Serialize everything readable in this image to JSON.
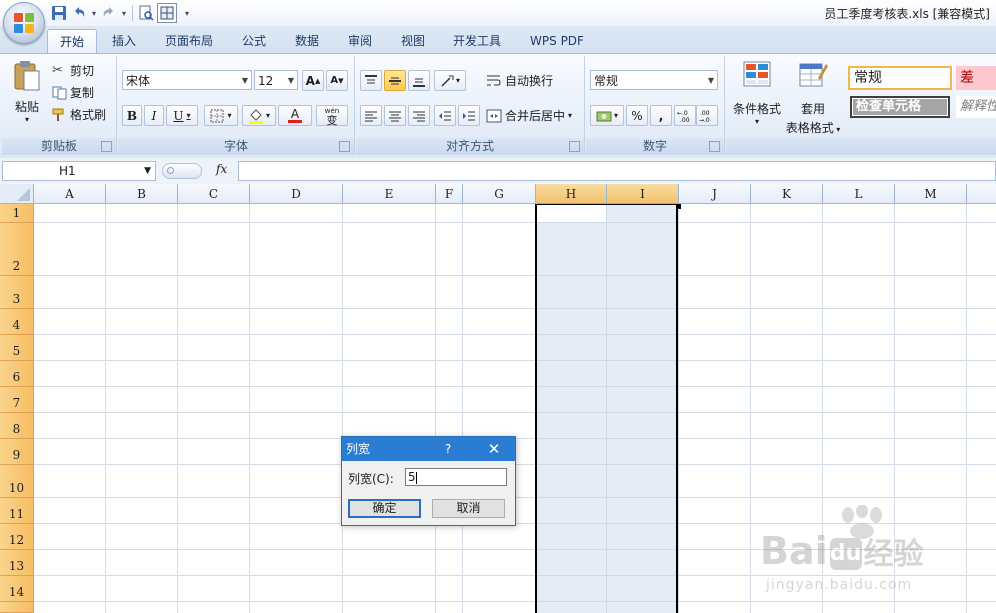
{
  "window": {
    "title": "员工季度考核表.xls  [兼容模式]"
  },
  "tabs": [
    {
      "label": "开始",
      "active": true
    },
    {
      "label": "插入",
      "active": false
    },
    {
      "label": "页面布局",
      "active": false
    },
    {
      "label": "公式",
      "active": false
    },
    {
      "label": "数据",
      "active": false
    },
    {
      "label": "审阅",
      "active": false
    },
    {
      "label": "视图",
      "active": false
    },
    {
      "label": "开发工具",
      "active": false
    },
    {
      "label": "WPS PDF",
      "active": false
    }
  ],
  "ribbon": {
    "clipboard": {
      "label": "剪贴板",
      "paste": "粘贴",
      "cut": "剪切",
      "copy": "复制",
      "format_painter": "格式刷"
    },
    "font": {
      "label": "字体",
      "font_name": "宋体",
      "font_size": "12",
      "grow": "A",
      "shrink": "A",
      "bold": "B",
      "italic": "I",
      "underline": "U",
      "font_color_glyph": "A",
      "phonetic": "wén",
      "phonetic_char": "变"
    },
    "alignment": {
      "label": "对齐方式",
      "wrap_text": "自动换行",
      "merge_center": "合并后居中"
    },
    "number": {
      "label": "数字",
      "format": "常规",
      "percent": "%",
      "comma": ","
    },
    "styles": {
      "conditional_format": "条件格式",
      "table_format_line1": "套用",
      "table_format_line2": "表格格式",
      "style_normal": "常规",
      "style_bad": "差",
      "style_check_cell": "检查单元格",
      "style_explanatory": "解释性"
    }
  },
  "formula_bar": {
    "name_box": "H1",
    "fx": "fx"
  },
  "grid": {
    "columns": [
      "A",
      "B",
      "C",
      "D",
      "E",
      "F",
      "G",
      "H",
      "I",
      "J",
      "K",
      "L",
      "M"
    ],
    "rows": [
      "1",
      "2",
      "3",
      "4",
      "5",
      "6",
      "7",
      "8",
      "9",
      "10",
      "11",
      "12",
      "13",
      "14"
    ],
    "selected_columns": [
      "H",
      "I"
    ]
  },
  "dialog": {
    "title": "列宽",
    "help": "?",
    "close": "✕",
    "field_label": "列宽(C):",
    "field_value": "5",
    "ok": "确定",
    "cancel": "取消"
  },
  "watermark": {
    "brand": "Bai",
    "brand_after": "du",
    "product": "经验",
    "url": "jingyan.baidu.com"
  },
  "colors": {
    "accent": "#2b7cd3",
    "row_header": "#f6bd62",
    "selection": "#c8d4ea"
  }
}
